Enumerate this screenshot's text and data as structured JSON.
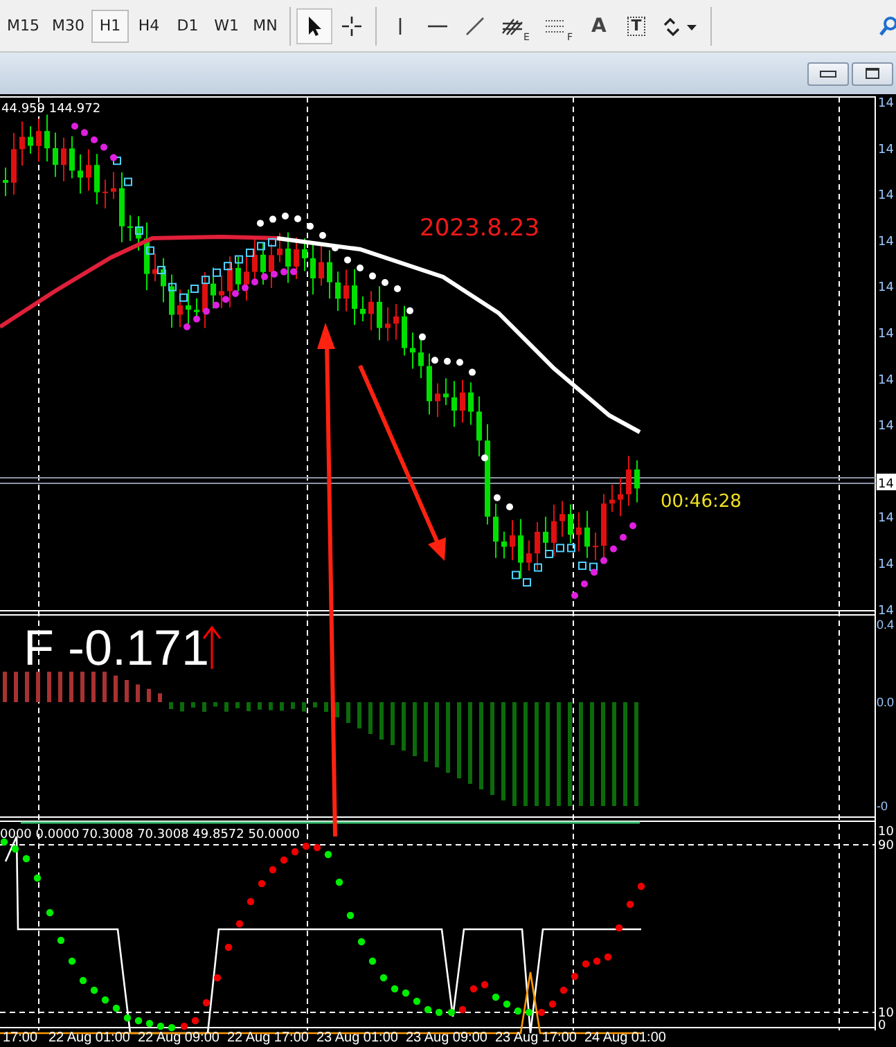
{
  "toolbar": {
    "timeframes": [
      {
        "label": "M15",
        "selected": false
      },
      {
        "label": "M30",
        "selected": false
      },
      {
        "label": "H1",
        "selected": true
      },
      {
        "label": "H4",
        "selected": false
      },
      {
        "label": "D1",
        "selected": false
      },
      {
        "label": "W1",
        "selected": false
      },
      {
        "label": "MN",
        "selected": false
      }
    ],
    "tools": [
      {
        "kind": "cursor",
        "selected": true
      },
      {
        "kind": "crosshair",
        "selected": false
      },
      {
        "kind": "vline",
        "selected": false
      },
      {
        "kind": "hline",
        "selected": false
      },
      {
        "kind": "trendline",
        "selected": false
      },
      {
        "kind": "fibo",
        "glyph": "E",
        "selected": false
      },
      {
        "kind": "grid",
        "glyph": "F",
        "selected": false
      },
      {
        "kind": "text",
        "glyph": "A",
        "selected": false
      },
      {
        "kind": "label",
        "glyph": "T",
        "selected": false
      },
      {
        "kind": "shapes",
        "selected": false
      }
    ]
  },
  "chart": {
    "ohlc_label": "44.959 144.972",
    "annotation": "2023.8.23",
    "timer": "00:46:28",
    "price_axis": [
      "14",
      "14",
      "14",
      "14",
      "14",
      "14",
      "14",
      "14",
      "14",
      "14",
      "14"
    ],
    "current_price": "14"
  },
  "macd": {
    "label": "F -0.171",
    "axis": [
      "0.4",
      "0.0",
      "-0"
    ]
  },
  "oscillator": {
    "values": "0000 0.0000",
    "values_2": "70.3008 70.3008 49.8572 50.0000",
    "axis": [
      "10",
      "90",
      "10",
      "0"
    ]
  },
  "time_axis": [
    "17:00",
    "22 Aug 01:00",
    "22 Aug 09:00",
    "22 Aug 17:00",
    "23 Aug 01:00",
    "23 Aug 09:00",
    "23 Aug 17:00",
    "24 Aug 01:00"
  ]
}
